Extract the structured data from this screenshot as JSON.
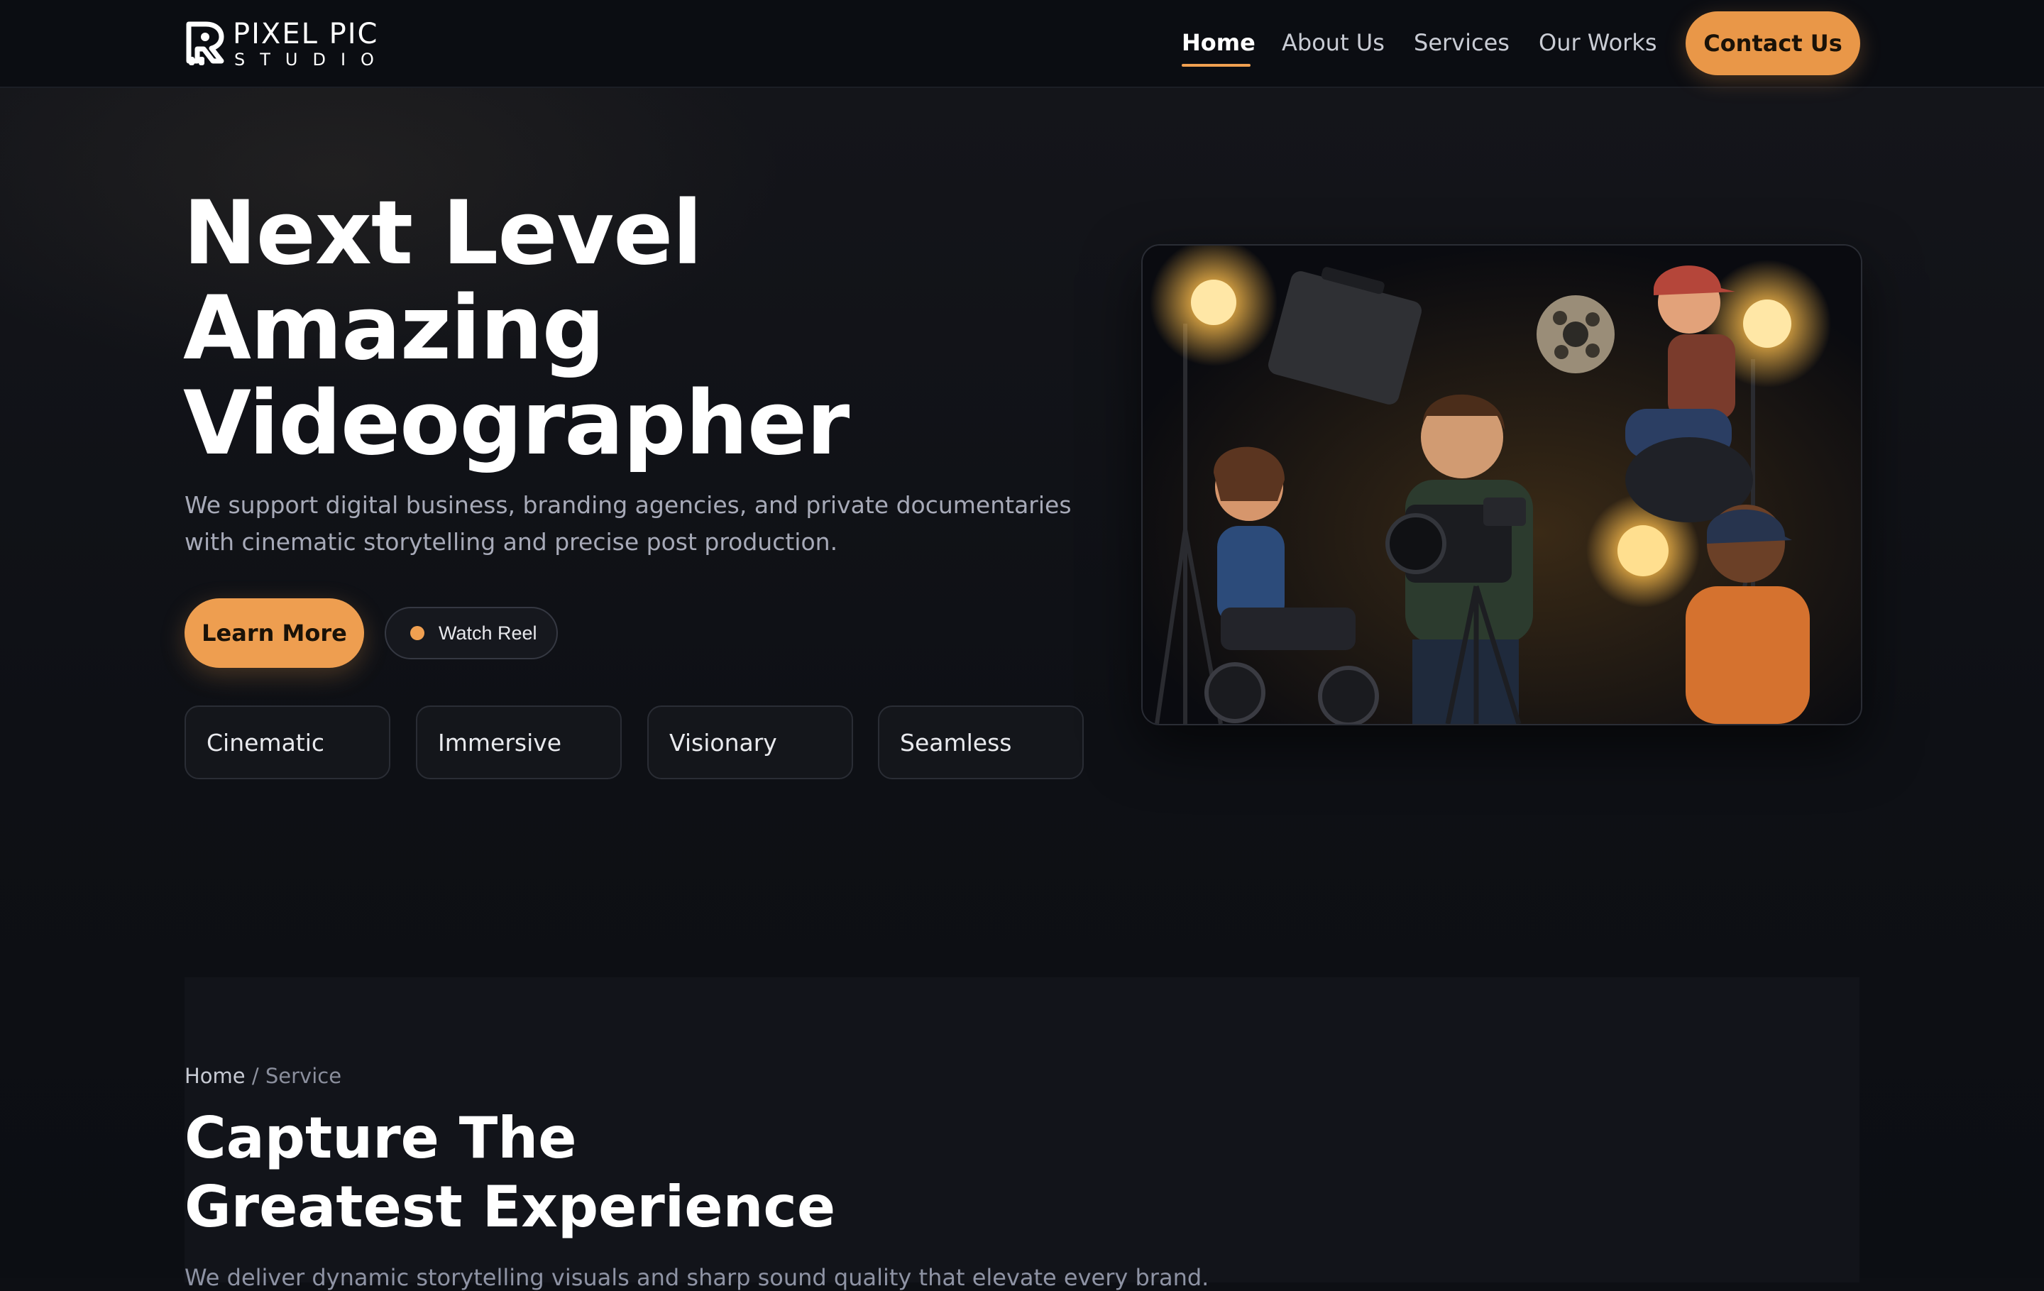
{
  "brand": {
    "name_line1": "PIXEL PIC",
    "name_line2": "STUDIO",
    "accent_color": "#ee9e50",
    "background_color": "#0d0f14"
  },
  "nav": {
    "items": [
      {
        "label": "Home",
        "active": true
      },
      {
        "label": "About Us",
        "active": false
      },
      {
        "label": "Services",
        "active": false
      },
      {
        "label": "Our Works",
        "active": false
      }
    ],
    "cta_label": "Contact Us"
  },
  "hero": {
    "title_lines": [
      "Next Level",
      "Amazing",
      "Videographer"
    ],
    "subtitle": "We support digital business, branding agencies, and private documentaries with cinematic storytelling and precise post production.",
    "primary_button": "Learn More",
    "secondary_button": "Watch Reel",
    "tags": [
      "Cinematic",
      "Immersive",
      "Visionary",
      "Seamless"
    ],
    "image_icon": "film-crew-illustration"
  },
  "service_section": {
    "breadcrumb": {
      "home": "Home",
      "separator": "/",
      "current": "Service"
    },
    "title_lines": [
      "Capture The",
      "Greatest Experience"
    ],
    "text": "We deliver dynamic storytelling visuals and sharp sound quality that elevate every brand."
  }
}
